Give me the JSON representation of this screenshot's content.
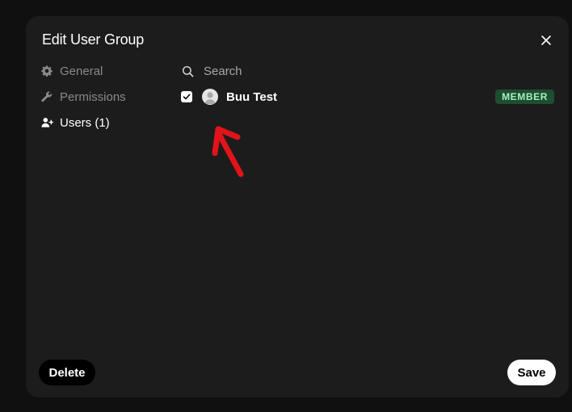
{
  "dialog": {
    "title": "Edit User Group"
  },
  "sidebar": {
    "items": [
      {
        "label": "General",
        "icon": "gear-icon",
        "active": false
      },
      {
        "label": "Permissions",
        "icon": "wrench-icon",
        "active": false
      },
      {
        "label": "Users (1)",
        "icon": "user-plus-icon",
        "active": true
      }
    ]
  },
  "search": {
    "placeholder": "Search",
    "value": ""
  },
  "users": [
    {
      "name": "Buu Test",
      "checked": true,
      "role": "MEMBER"
    }
  ],
  "footer": {
    "delete_label": "Delete",
    "save_label": "Save"
  },
  "colors": {
    "modal_bg": "#1c1c1c",
    "badge_bg": "#1e4d2f",
    "badge_text": "#a6f0c0",
    "annotation_arrow": "#e0141a"
  }
}
